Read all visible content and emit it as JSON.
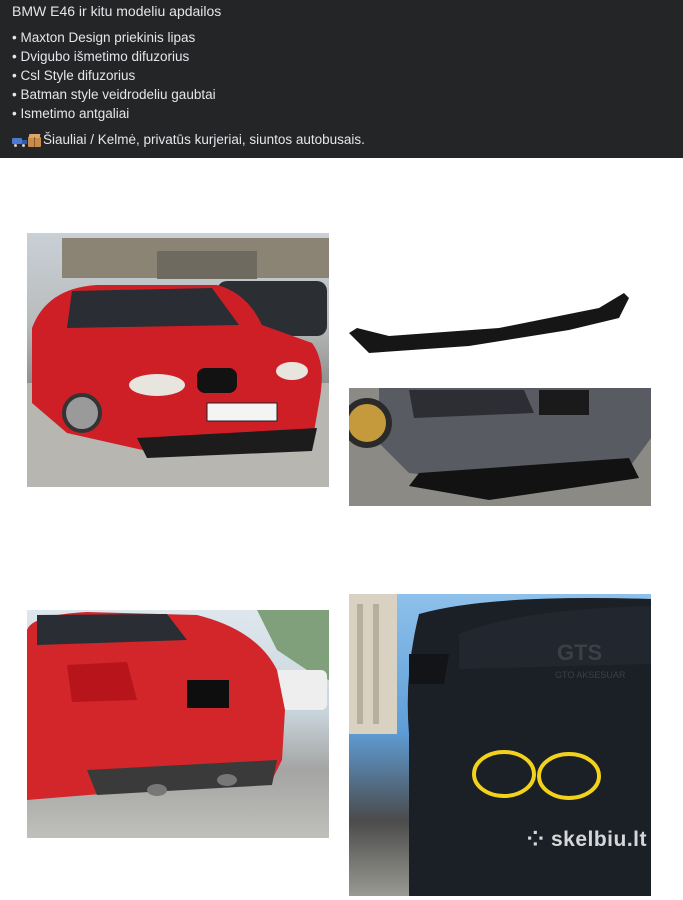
{
  "post": {
    "title": "BMW E46 ir kitu modeliu apdailos",
    "bullets": [
      "• Maxton Design priekinis lipas",
      "• Dvigubo išmetimo difuzorius",
      "• Csl Style difuzorius",
      "• Batman style veidrodeliu gaubtai",
      "• Ismetimo antgaliai"
    ],
    "location_icons": [
      "truck-icon",
      "package-icon"
    ],
    "location": "Šiauliai / Kelmė, privatūs kurjeriai, siuntos autobusais."
  },
  "gallery": {
    "photo_b_watermark_logo": "GTS",
    "photo_b_watermark_text": "GTO AKSESUAR",
    "photo_d_watermark": "skelbiu.lt"
  },
  "colors": {
    "header_bg": "#242526",
    "header_text": "#e4e6eb",
    "page_bg": "#ffffff"
  }
}
